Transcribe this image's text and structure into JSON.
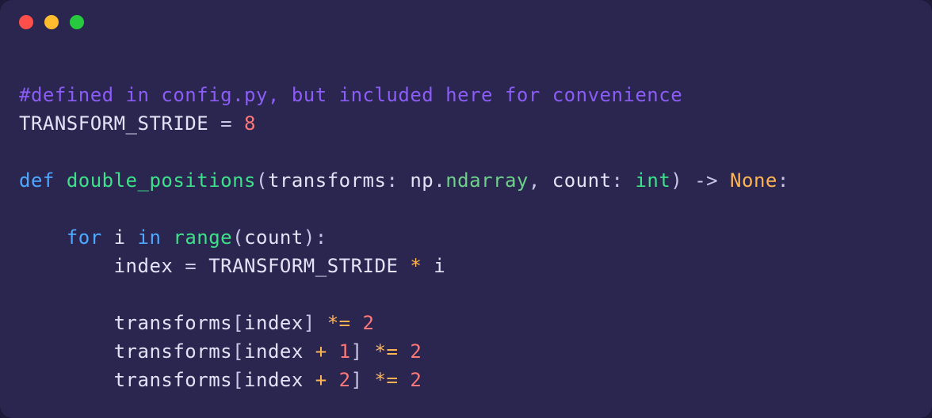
{
  "window": {
    "dots": [
      "red",
      "yellow",
      "green"
    ]
  },
  "code": {
    "comment": "#defined in config.py, but included here for convenience",
    "const_name": "TRANSFORM_STRIDE",
    "const_eq": " = ",
    "const_val": "8",
    "kw_def": "def",
    "fn_name": "double_positions",
    "param_open": "(",
    "param1_name": "transforms",
    "colon1": ": ",
    "param1_ns": "np",
    "dot1": ".",
    "param1_type": "ndarray",
    "comma": ", ",
    "param2_name": "count",
    "colon2": ": ",
    "param2_type": "int",
    "param_close": ")",
    "arrow": " -> ",
    "ret_type": "None",
    "colon_end": ":",
    "kw_for": "for",
    "loop_var": " i ",
    "kw_in": "in",
    "range_fn": "range",
    "range_open": "(",
    "range_arg": "count",
    "range_close": "):",
    "idx_lhs": "index",
    "idx_eq": " = ",
    "stride_ref": "TRANSFORM_STRIDE",
    "mul": " * ",
    "loop_i": "i",
    "arr_name": "transforms",
    "idx_open": "[",
    "idx_ref": "index",
    "plus": " + ",
    "one": "1",
    "two": "2",
    "idx_close": "]",
    "starop": " *= ",
    "rhs": "2"
  }
}
